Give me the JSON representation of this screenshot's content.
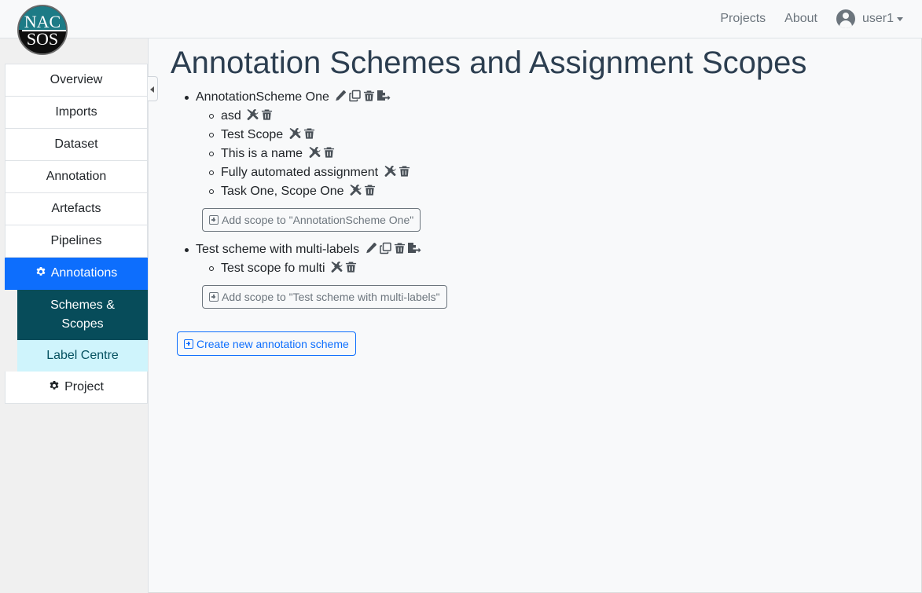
{
  "logo": {
    "line1": "NAC",
    "line2": "SOS"
  },
  "navbar": {
    "links": [
      "Projects",
      "About"
    ],
    "user": "user1"
  },
  "sidebar": {
    "items": [
      "Overview",
      "Imports",
      "Dataset",
      "Annotation",
      "Artefacts",
      "Pipelines"
    ],
    "active": "Annotations",
    "sub_items": [
      "Schemes & Scopes",
      "Label Centre"
    ],
    "project": "Project"
  },
  "main": {
    "title": "Annotation Schemes and Assignment Scopes",
    "schemes": [
      {
        "name": "AnnotationScheme One",
        "scopes": [
          "asd",
          "Test Scope",
          "This is a name",
          "Fully automated assignment",
          "Task One, Scope One"
        ],
        "add_scope_label": "Add scope to \"AnnotationScheme One\""
      },
      {
        "name": "Test scheme with multi-labels",
        "scopes": [
          "Test scope fo multi"
        ],
        "add_scope_label": "Add scope to \"Test scheme with multi-labels\""
      }
    ],
    "create_label": "Create new annotation scheme"
  },
  "colors": {
    "primary": "#0d6efd",
    "sidebar_dark": "#074c5a",
    "sidebar_light": "#cff4fc",
    "icon": "#495057"
  }
}
